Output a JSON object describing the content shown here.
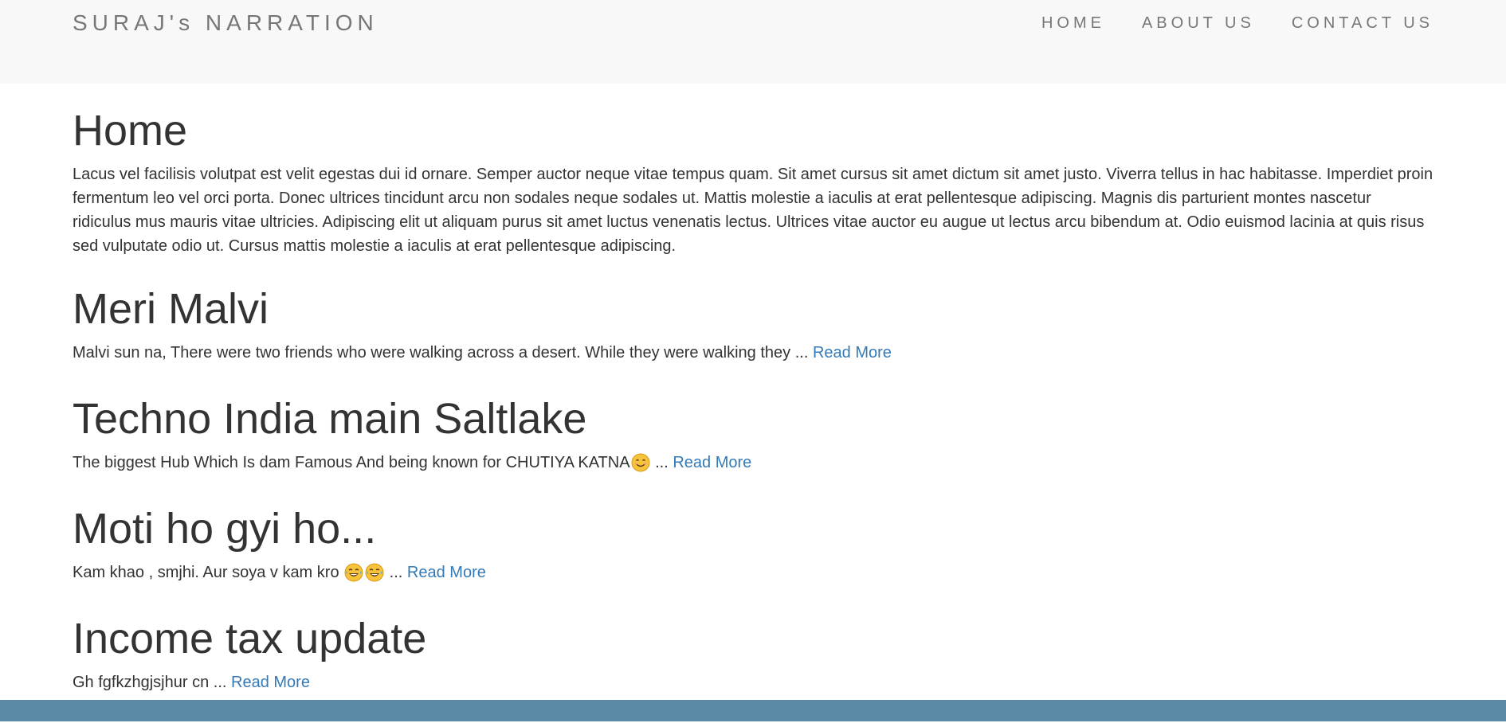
{
  "navbar": {
    "brand": "SURAJ's NARRATION",
    "links": [
      "HOME",
      "ABOUT US",
      "CONTACT US"
    ]
  },
  "home": {
    "title": "Home",
    "text": "Lacus vel facilisis volutpat est velit egestas dui id ornare. Semper auctor neque vitae tempus quam. Sit amet cursus sit amet dictum sit amet justo. Viverra tellus in hac habitasse. Imperdiet proin fermentum leo vel orci porta. Donec ultrices tincidunt arcu non sodales neque sodales ut. Mattis molestie a iaculis at erat pellentesque adipiscing. Magnis dis parturient montes nascetur ridiculus mus mauris vitae ultricies. Adipiscing elit ut aliquam purus sit amet luctus venenatis lectus. Ultrices vitae auctor eu augue ut lectus arcu bibendum at. Odio euismod lacinia at quis risus sed vulputate odio ut. Cursus mattis molestie a iaculis at erat pellentesque adipiscing."
  },
  "posts": [
    {
      "title": "Meri Malvi",
      "excerpt": "Malvi sun na, There were two friends who were walking across a desert. While they were walking they",
      "ellipsis": " ... ",
      "read_more": "Read More"
    },
    {
      "title": "Techno India main Saltlake",
      "excerpt": "The biggest Hub Which Is dam Famous And being known for CHUTIYA KATNA",
      "emoji": [
        "smiling-face-icon"
      ],
      "ellipsis": " ... ",
      "read_more": "Read More"
    },
    {
      "title": "Moti ho gyi ho...",
      "excerpt": "Kam khao , smjhi. Aur soya v kam kro ",
      "emoji": [
        "tears-of-joy-icon",
        "tears-of-joy-icon"
      ],
      "ellipsis": " ... ",
      "read_more": "Read More"
    },
    {
      "title": "Income tax update",
      "excerpt": "Gh fgfkzhgjsjhur cn",
      "ellipsis": " ... ",
      "read_more": "Read More"
    }
  ],
  "colors": {
    "navbar_bg": "#f8f8f8",
    "link": "#337ab7",
    "footer": "#5a8aa6",
    "text": "#333333"
  }
}
